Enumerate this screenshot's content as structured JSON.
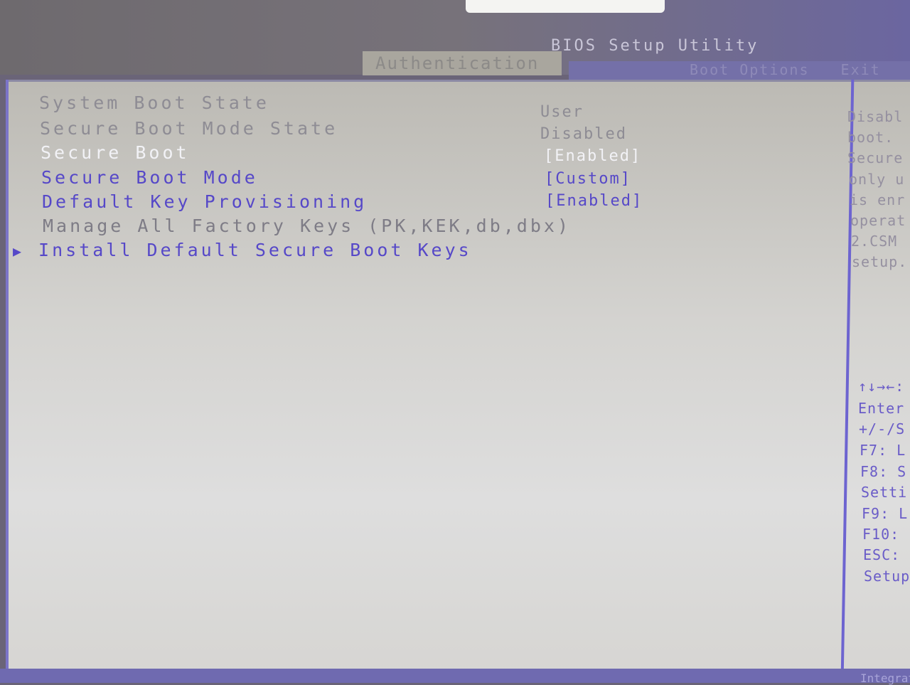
{
  "header": {
    "title": "BIOS Setup Utility",
    "active_tab": "Authentication",
    "other_tabs": [
      "Boot Options",
      "Exit"
    ]
  },
  "settings": [
    {
      "label": "System Boot State",
      "value": "User",
      "style": "grey"
    },
    {
      "label": "Secure Boot Mode State",
      "value": "Disabled",
      "style": "grey"
    },
    {
      "label": "Secure Boot",
      "value": "[Enabled]",
      "style": "selected"
    },
    {
      "label": "Secure Boot Mode",
      "value": "[Custom]",
      "style": "blue"
    },
    {
      "label": "Default Key Provisioning",
      "value": "[Enabled]",
      "style": "blue"
    },
    {
      "label": "Manage All Factory Keys (PK,KEK,db,dbx)",
      "style": "grey"
    },
    {
      "label": "Install Default Secure Boot Keys",
      "style": "submenu",
      "arrow": "▶"
    }
  ],
  "help_text": [
    "Disabl",
    "boot.",
    "Secure",
    "only u",
    "is enr",
    "operat",
    "2.CSM",
    "setup."
  ],
  "key_legend": [
    "↑↓→←:",
    "Enter",
    "+/-/S",
    "F7: L",
    "F8: S",
    "Setti",
    "F9: L",
    "F10:",
    "ESC:",
    "Setup"
  ],
  "footer_text": "Integrat",
  "colors": {
    "selected": "#f2f2f6",
    "item": "#5648c8",
    "readonly": "#8e8c94",
    "divider": "#6d64d0"
  }
}
